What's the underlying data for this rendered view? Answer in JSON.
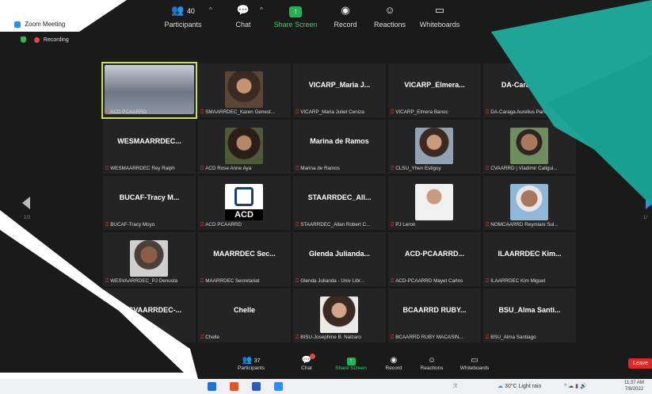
{
  "window": {
    "title": "Zoom Meeting",
    "recording_label": "Recording"
  },
  "toolbar_top": {
    "participants_count": "40",
    "items": [
      {
        "label": "Participants"
      },
      {
        "label": "Chat"
      },
      {
        "label": "Share Screen"
      },
      {
        "label": "Record"
      },
      {
        "label": "Reactions"
      },
      {
        "label": "Whiteboards"
      }
    ]
  },
  "pages": {
    "left": "1/2",
    "right": "1/"
  },
  "tiles": [
    {
      "name": "",
      "caption": "ACD PCAARRD",
      "photo": "group",
      "active": true
    },
    {
      "name": "",
      "caption": "SMAARRDEC_Karen Genest...",
      "photo": "woman"
    },
    {
      "name": "VICARP_Maria J...",
      "caption": "VICARP_Maria Juliet Ceniza"
    },
    {
      "name": "VICARP_Elmera...",
      "caption": "VICARP_Elmera Banoc"
    },
    {
      "name": "DA-Caraga Aur...",
      "caption": "DA-Caraga Aurelius Parido..."
    },
    {
      "name": "WESMAARRDEC...",
      "caption": "WESMAARRDEC Rey Ralph"
    },
    {
      "name": "",
      "caption": "ACD Rose Anne Aya",
      "photo": "woman2"
    },
    {
      "name": "Marina de Ramos",
      "caption": "Marina de Ramos"
    },
    {
      "name": "",
      "caption": "CLSU_Yhen Estigoy",
      "photo": "woman3"
    },
    {
      "name": "",
      "caption": "CVAARRD | Vladimir Caligui...",
      "photo": "man"
    },
    {
      "name": "BUCAF-Tracy M...",
      "caption": "BUCAF-Tracy Moyo"
    },
    {
      "name": "",
      "caption": "ACD PCAARRD",
      "photo": "logo",
      "logo_text": "ACD"
    },
    {
      "name": "STAARRDEC_All...",
      "caption": "STAARRDEC_Allan Robert C..."
    },
    {
      "name": "",
      "caption": "PJ Leron",
      "photo": "man2"
    },
    {
      "name": "",
      "caption": "NOMCAARRD Reymlani Sul...",
      "photo": "man3"
    },
    {
      "name": "",
      "caption": "WESVAARRDEC_PJ Denusta",
      "photo": "man4"
    },
    {
      "name": "MAARRDEC Sec...",
      "caption": "MAARRDEC Secretariat"
    },
    {
      "name": "Glenda Julianda...",
      "caption": "Glenda Julianda - Univ Libr..."
    },
    {
      "name": "ACD-PCAARRD...",
      "caption": "ACD-PCAARRD Mayet Carlos"
    },
    {
      "name": "ILAARRDEC Kim...",
      "caption": "ILAARRDEC Kim Miguel"
    },
    {
      "name": "WESVAARRDEC-...",
      "caption": "RDEC-Jylyn Corn..."
    },
    {
      "name": "Chelle",
      "caption": "Chelle"
    },
    {
      "name": "",
      "caption": "BISU-Josephine B. Nalzaro",
      "photo": "woman4"
    },
    {
      "name": "BCAARRD RUBY...",
      "caption": "BCAARRD RUBY MACASIN..."
    },
    {
      "name": "BSU_Alma Santi...",
      "caption": "BSU_Alma Santiago"
    }
  ],
  "toolbar_bottom": {
    "participants_count": "37",
    "items": [
      {
        "label": "Participants"
      },
      {
        "label": "Chat"
      },
      {
        "label": "Share Screen"
      },
      {
        "label": "Record"
      },
      {
        "label": "Reactions"
      },
      {
        "label": "Whiteboards"
      }
    ],
    "leave_label": "Leave"
  },
  "taskbar": {
    "weather": "30°C  Light rain",
    "time": "11:37 AM",
    "date": "7/8/2022"
  }
}
